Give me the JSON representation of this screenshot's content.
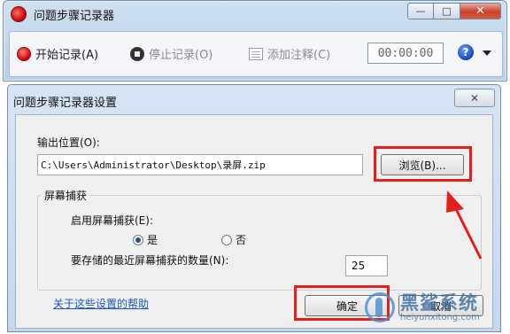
{
  "main_window": {
    "title": "问题步骤记录器",
    "controls": {
      "minimize": "—",
      "maximize": "□",
      "close": "✕"
    },
    "toolbar": {
      "start_label": "开始记录(A)",
      "stop_label": "停止记录(O)",
      "comment_label": "添加注释(C)",
      "timer": "00:00:00",
      "help": "?"
    }
  },
  "dialog": {
    "title": "问题步骤记录器设置",
    "close": "✕",
    "output_label": "输出位置(O):",
    "output_path": "C:\\Users\\Administrator\\Desktop\\录屏.zip",
    "browse_label": "浏览(B)...",
    "capture_group": "屏幕捕获",
    "enable_label": "启用屏幕捕获(E):",
    "yes_label": "是",
    "no_label": "否",
    "selected": "是",
    "count_label": "要存储的最近屏幕捕获的数量(N):",
    "count_value": "25",
    "help_link": "关于这些设置的帮助",
    "ok_label": "确定",
    "cancel_label": "取消"
  },
  "watermark": {
    "name": "黑鲨系统",
    "url": "heiyunxitong.com"
  },
  "annotation_color": "#e3201c"
}
